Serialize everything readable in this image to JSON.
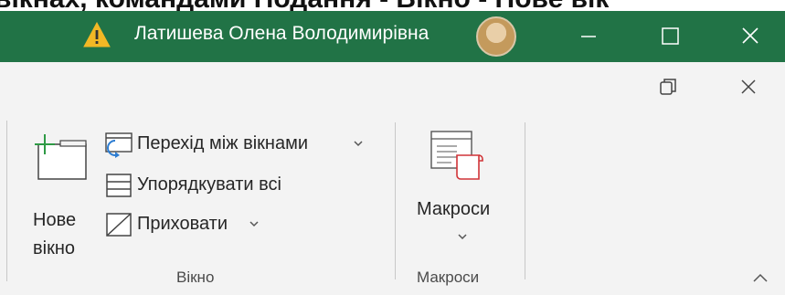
{
  "background_caption": "вікнах, командами Подання - Вікно - Нове вік",
  "titlebar": {
    "user_name": "Латишева Олена Володимирівна",
    "accent": "#217346"
  },
  "ribbon": {
    "groups": [
      {
        "label": "Вікно",
        "new_window": {
          "line1": "Нове",
          "line2": "вікно"
        },
        "switch_windows": "Перехід між вікнами",
        "arrange_all": "Упорядкувати всі",
        "hide": "Приховати"
      },
      {
        "label": "Макроси",
        "macros": "Макроси"
      }
    ]
  },
  "icons": [
    "warning-icon",
    "avatar",
    "minimize-icon",
    "maximize-icon",
    "close-icon",
    "restore-icon",
    "new-window-icon",
    "switch-windows-icon",
    "arrange-all-icon",
    "hide-icon",
    "macros-icon",
    "chevron-down-icon",
    "collapse-ribbon-icon"
  ]
}
